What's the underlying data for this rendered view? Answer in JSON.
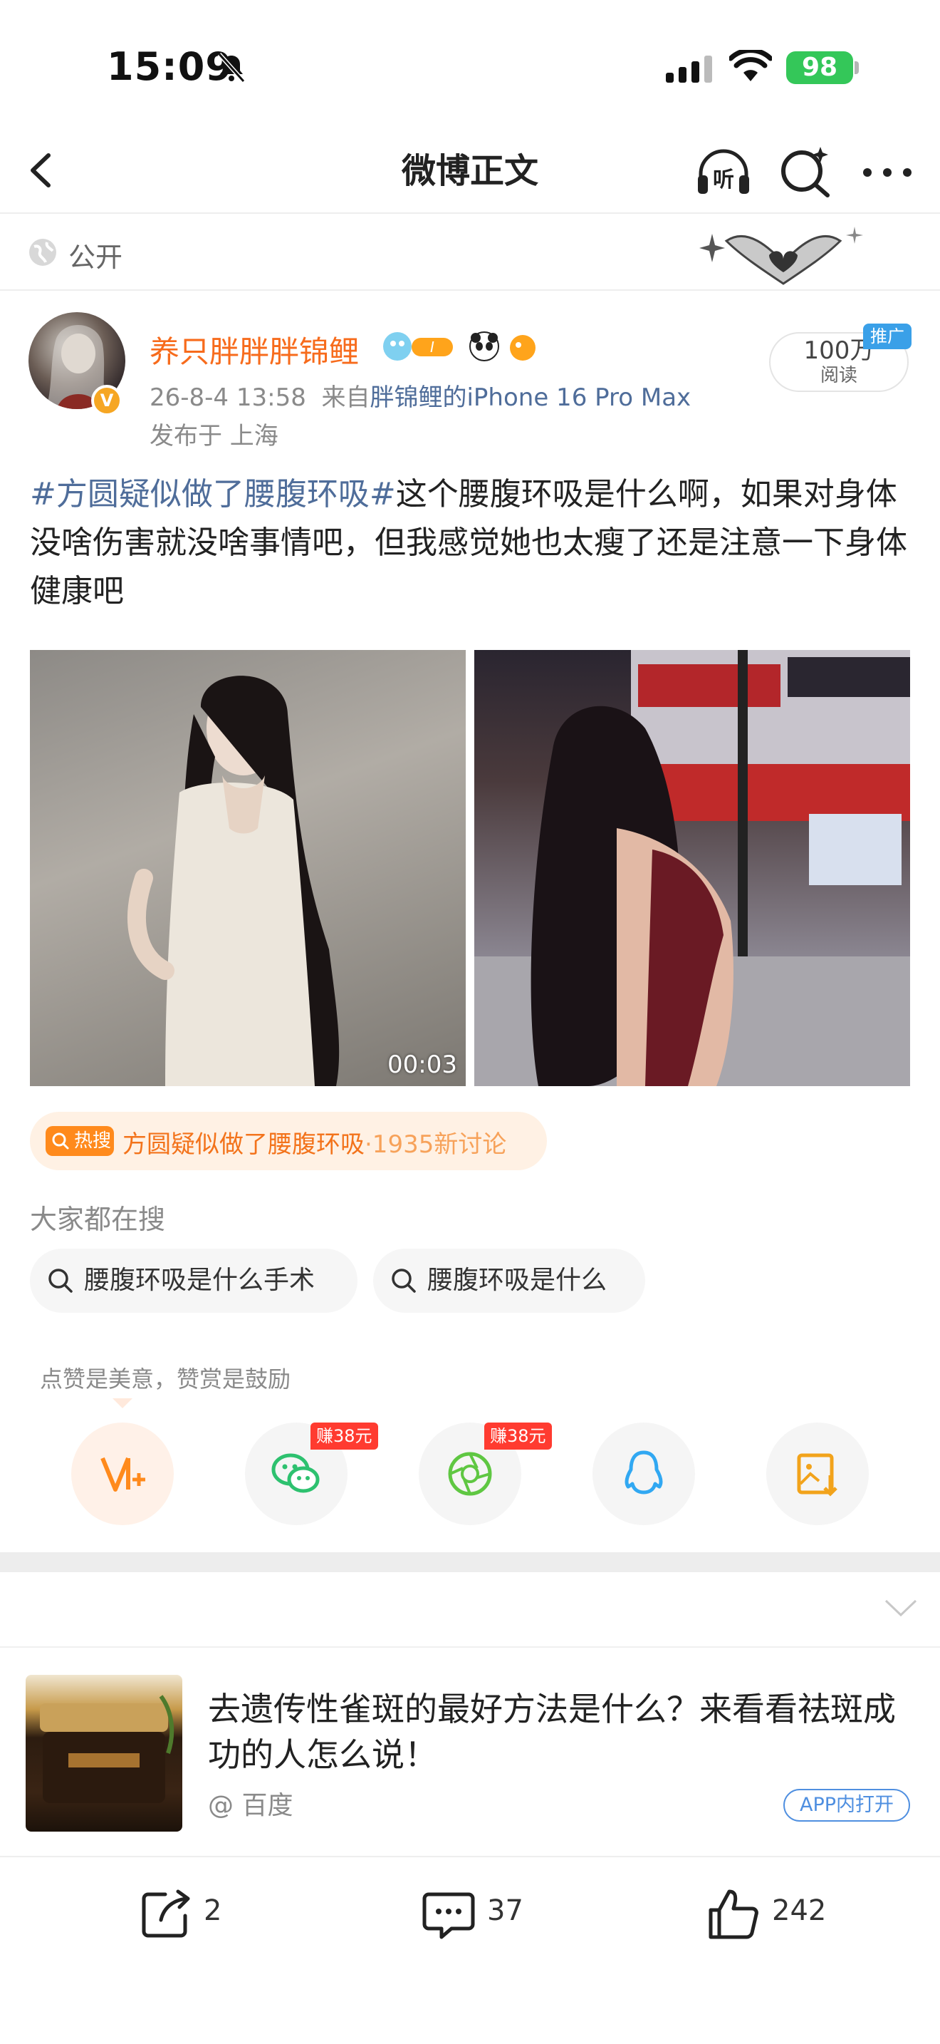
{
  "status_bar": {
    "time": "15:09",
    "battery": "98"
  },
  "nav": {
    "title": "微博正文"
  },
  "visibility": {
    "label": "公开"
  },
  "post": {
    "author": "养只胖胖胖锦鲤",
    "date": "26-8-4 13:58",
    "source_prefix": "来自",
    "source": "胖锦鲤的iPhone 16 Pro Max",
    "location": "发布于 上海",
    "reads": "100万",
    "reads_label": "阅读",
    "promo_tag": "推广",
    "topic": "#方圆疑似做了腰腹环吸#",
    "body": "这个腰腹环吸是什么啊，如果对身体没啥伤害就没啥事情吧，但我感觉她也太瘦了还是注意一下身体健康吧",
    "video_duration": "00:03"
  },
  "hot_search": {
    "tag": "热搜",
    "title": "方圆疑似做了腰腹环吸",
    "count": "·1935新讨论"
  },
  "everyone_search": {
    "label": "大家都在搜",
    "items": [
      "腰腹环吸是什么手术",
      "腰腹环吸是什么"
    ]
  },
  "share": {
    "note": "点赞是美意，赞赏是鼓励",
    "earn1": "赚38元",
    "earn2": "赚38元"
  },
  "ad": {
    "title": "去遗传性雀斑的最好方法是什么？来看看祛斑成功的人怎么说！",
    "source": "@ 百度",
    "open": "APP内打开"
  },
  "toolbar": {
    "repost": "2",
    "comment": "37",
    "like": "242"
  },
  "colors": {
    "accent": "#f76b1c",
    "link": "#4f6d9a",
    "hot": "#ff8a1c",
    "battery": "#34c759"
  }
}
